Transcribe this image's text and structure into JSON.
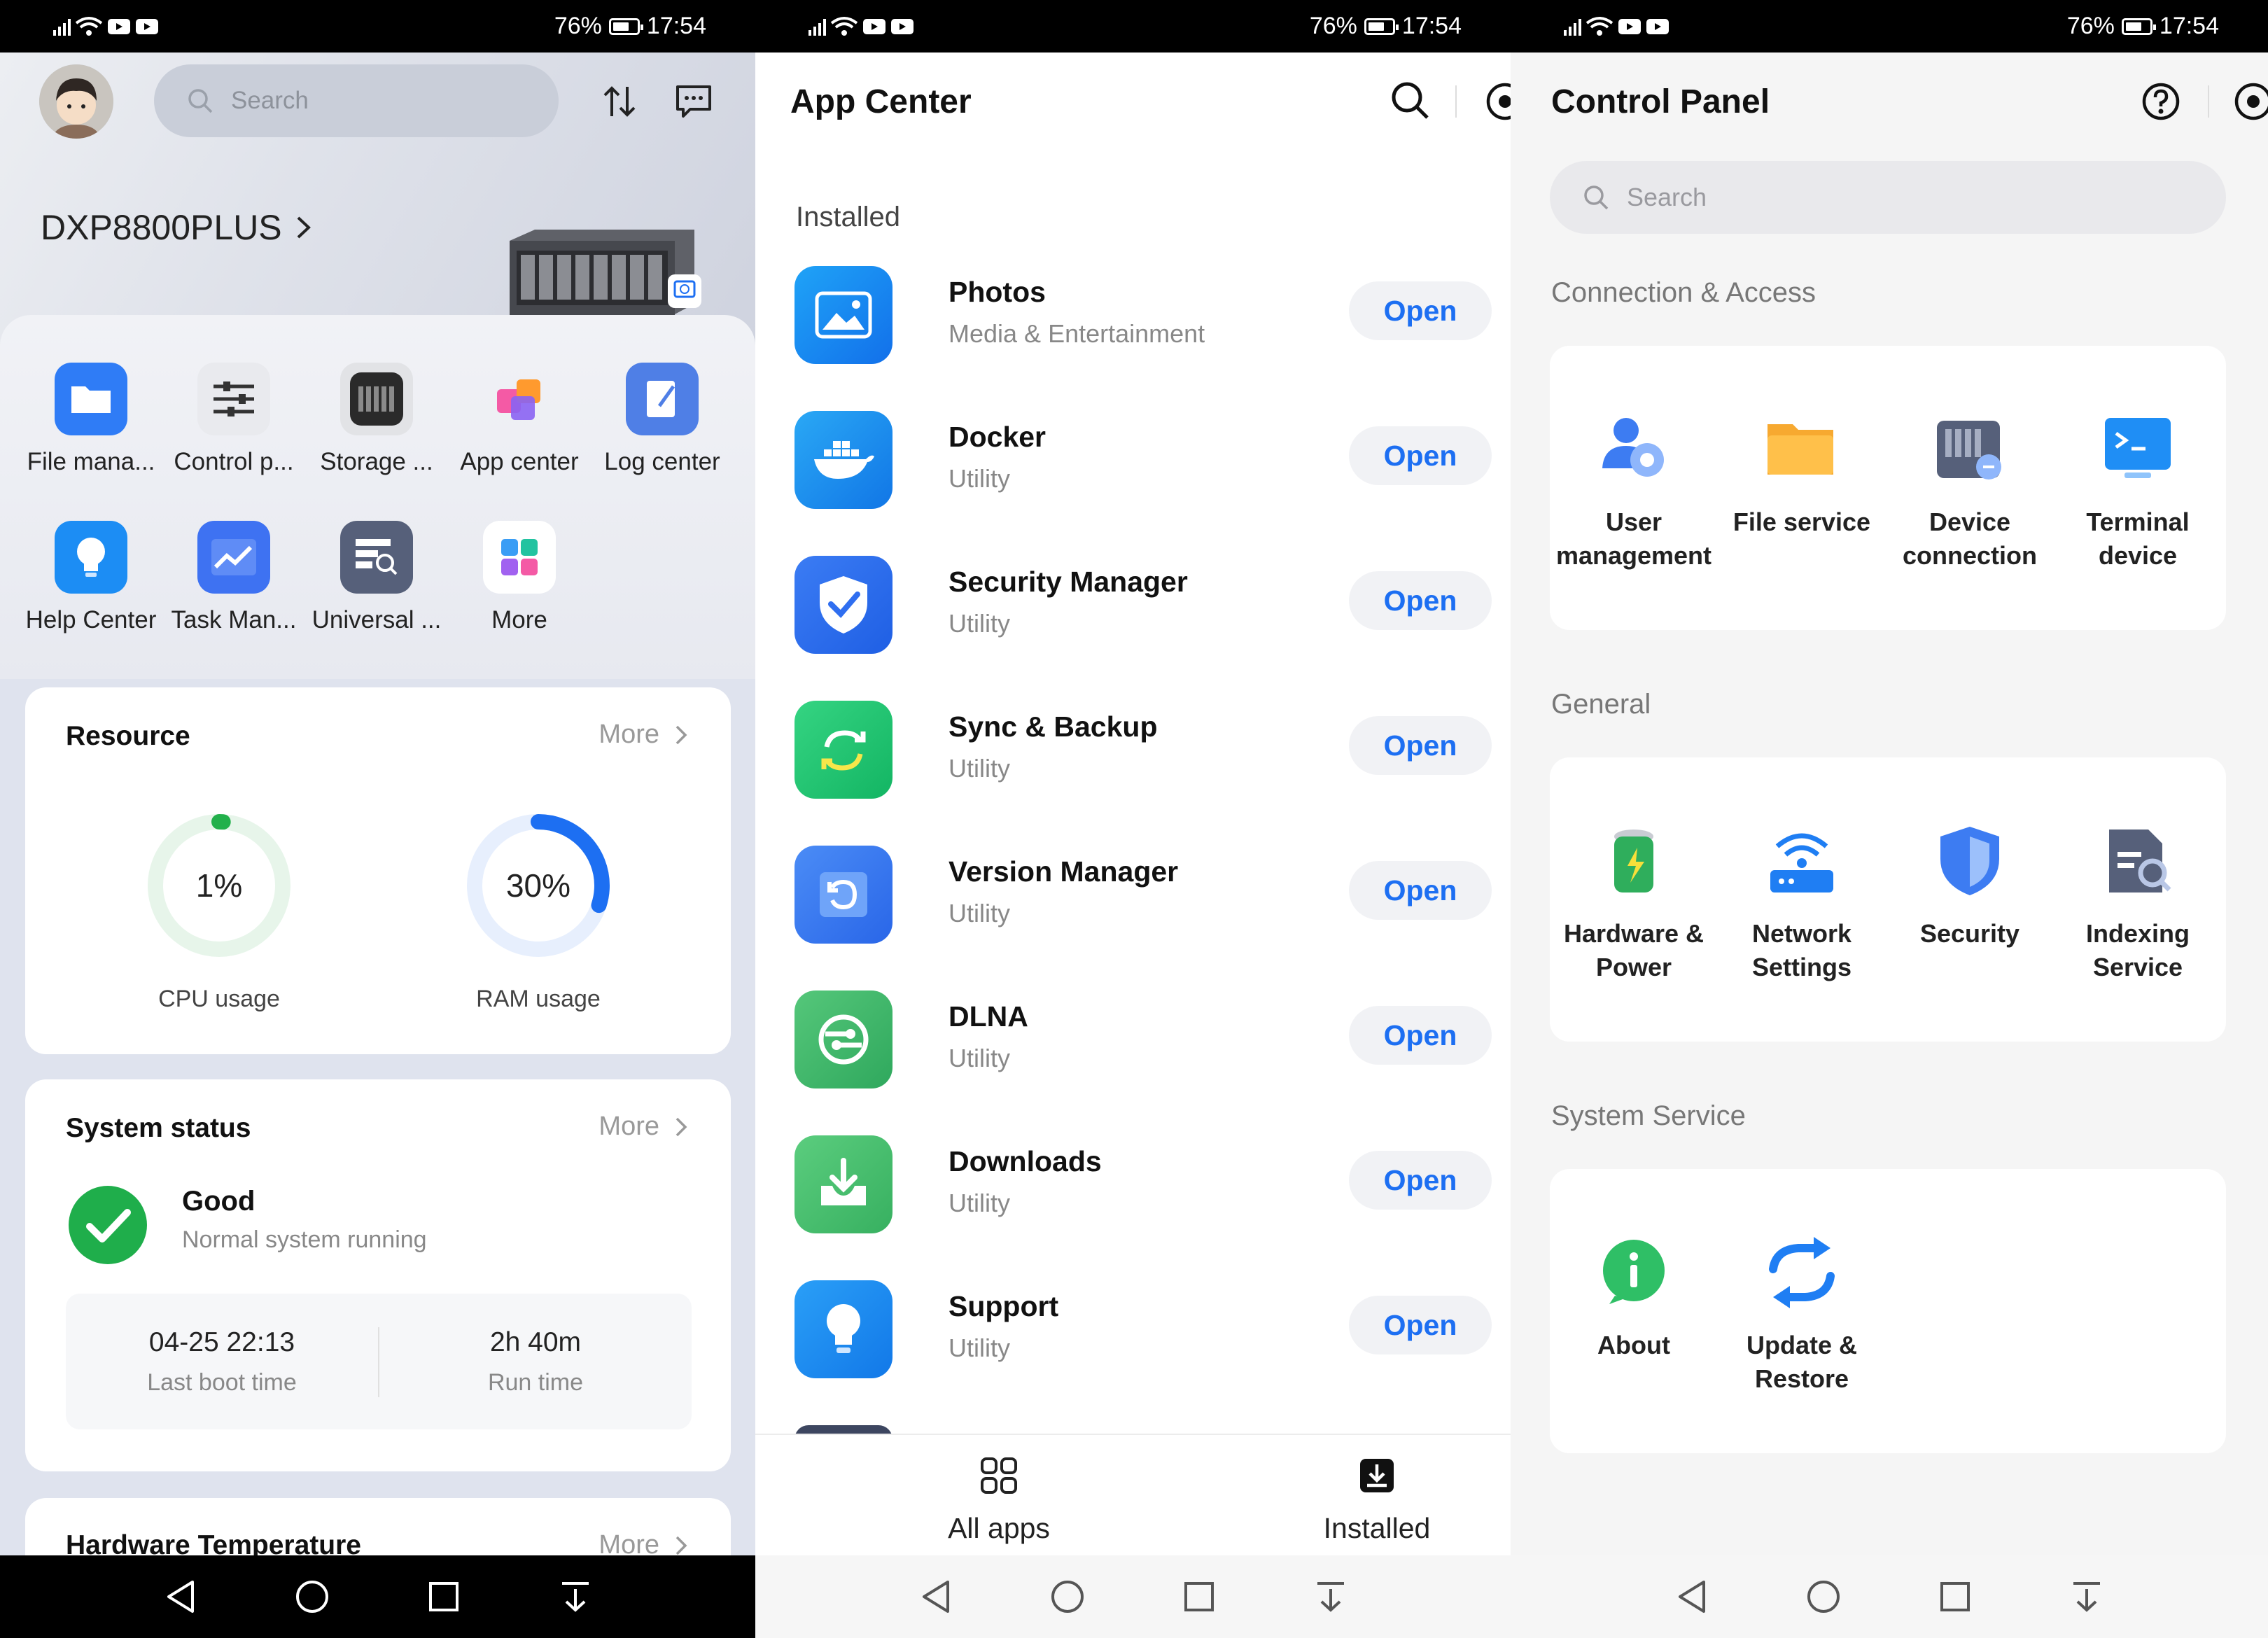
{
  "status_bar": {
    "battery": "76%",
    "time": "17:54"
  },
  "home": {
    "search_placeholder": "Search",
    "device_name": "DXP8800PLUS",
    "shortcuts": [
      {
        "label": "File mana...",
        "icon": "folder-icon",
        "color": "#2f7cf6"
      },
      {
        "label": "Control p...",
        "icon": "sliders-icon",
        "color": "#e9eaee"
      },
      {
        "label": "Storage ...",
        "icon": "storage-icon",
        "color": "#2a2a2a"
      },
      {
        "label": "App center",
        "icon": "app-center-icon",
        "color": "#a46ef2"
      },
      {
        "label": "Log center",
        "icon": "log-icon",
        "color": "#4f7fe6"
      },
      {
        "label": "Help Center",
        "icon": "lightbulb-icon",
        "color": "#1c8df4"
      },
      {
        "label": "Task Man...",
        "icon": "task-chart-icon",
        "color": "#3e72f2"
      },
      {
        "label": "Universal ...",
        "icon": "universal-search-icon",
        "color": "#56607a"
      },
      {
        "label": "More",
        "icon": "more-grid-icon",
        "color": "#ffffff"
      }
    ],
    "resource": {
      "title": "Resource",
      "more": "More",
      "cpu": {
        "value": "1%",
        "fraction": 0.01,
        "label": "CPU usage",
        "color": "#22b04b"
      },
      "ram": {
        "value": "30%",
        "fraction": 0.3,
        "label": "RAM usage",
        "color": "#1d6ff2"
      }
    },
    "system_status": {
      "title": "System status",
      "more": "More",
      "state": "Good",
      "detail": "Normal system running",
      "boot_time": "04-25 22:13",
      "boot_label": "Last boot time",
      "run_time": "2h 40m",
      "run_label": "Run time"
    },
    "hardware": {
      "title": "Hardware Temperature",
      "more": "More"
    }
  },
  "app_center": {
    "title": "App Center",
    "section": "Installed",
    "open_label": "Open",
    "apps": [
      {
        "name": "Photos",
        "category": "Media & Entertainment",
        "icon": "photos-icon",
        "color": "#1690f5"
      },
      {
        "name": "Docker",
        "category": "Utility",
        "icon": "docker-icon",
        "color": "#1b8ff0"
      },
      {
        "name": "Security Manager",
        "category": "Utility",
        "icon": "shield-check-icon",
        "color": "#2f6ef0"
      },
      {
        "name": "Sync & Backup",
        "category": "Utility",
        "icon": "sync-icon",
        "color": "#1fc36f"
      },
      {
        "name": "Version Manager",
        "category": "Utility",
        "icon": "version-icon",
        "color": "#3a7cf2"
      },
      {
        "name": "DLNA",
        "category": "Utility",
        "icon": "dlna-icon",
        "color": "#3bb66a"
      },
      {
        "name": "Downloads",
        "category": "Utility",
        "icon": "download-icon",
        "color": "#48c06a"
      },
      {
        "name": "Support",
        "category": "Utility",
        "icon": "support-bulb-icon",
        "color": "#1c8df4"
      }
    ],
    "tabs": [
      {
        "label": "All apps",
        "icon": "all-apps-icon"
      },
      {
        "label": "Installed",
        "icon": "installed-icon"
      }
    ]
  },
  "control_panel": {
    "title": "Control Panel",
    "search_placeholder": "Search",
    "sections": [
      {
        "title": "Connection & Access",
        "items": [
          {
            "label": "User management",
            "icon": "user-management-icon"
          },
          {
            "label": "File service",
            "icon": "file-service-icon"
          },
          {
            "label": "Device connection",
            "icon": "device-connection-icon"
          },
          {
            "label": "Terminal device",
            "icon": "terminal-icon"
          }
        ]
      },
      {
        "title": "General",
        "items": [
          {
            "label": "Hardware & Power",
            "icon": "battery-icon"
          },
          {
            "label": "Network Settings",
            "icon": "network-icon"
          },
          {
            "label": "Security",
            "icon": "security-shield-icon"
          },
          {
            "label": "Indexing Service",
            "icon": "indexing-icon"
          }
        ]
      },
      {
        "title": "System Service",
        "items": [
          {
            "label": "About",
            "icon": "about-info-icon"
          },
          {
            "label": "Update & Restore",
            "icon": "update-icon"
          }
        ]
      }
    ]
  }
}
